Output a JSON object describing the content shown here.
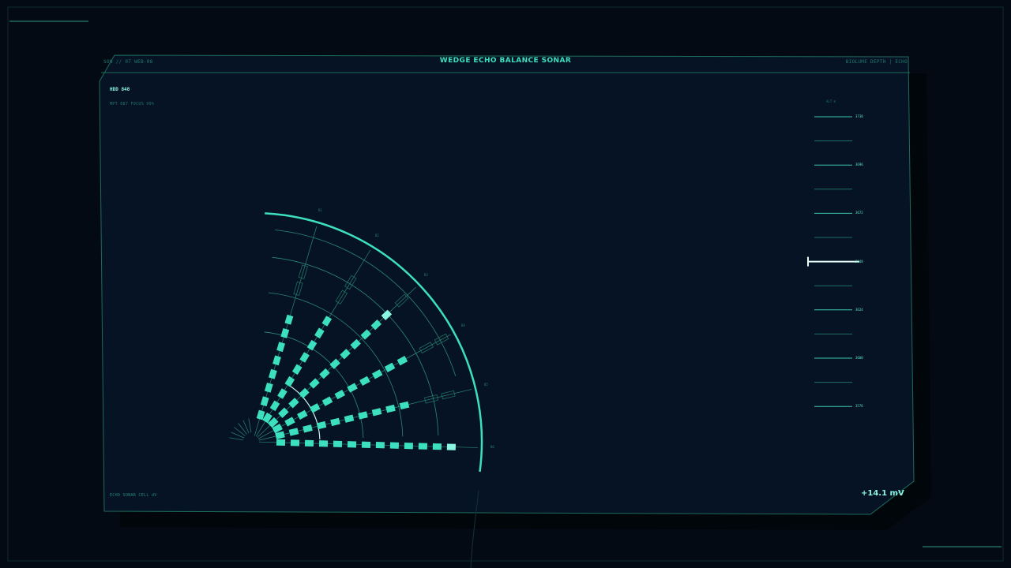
{
  "header": {
    "title": "WEDGE ECHO BALANCE SONAR",
    "left_code": "SON // 07  WEB-08",
    "right_code": "BIOLUME DEPTH | ECHO"
  },
  "status": {
    "hdd": "HDD 848",
    "sub": "MPT 087  FOCUS 99%"
  },
  "footer": {
    "left": "ECHO SONAR   CELL dV",
    "readout": "+14.1 mV"
  },
  "altimeter": {
    "title": "ALT m",
    "major_labels": [
      "3738",
      "3696",
      "3672",
      "3648",
      "3624",
      "3600",
      "3576"
    ],
    "cursor_index": 3
  },
  "sonar": {
    "beam_labels": [
      "B1",
      "B2",
      "B3",
      "B4",
      "B5",
      "B6"
    ],
    "beam_levels": [
      0.61,
      0.66,
      0.84,
      0.8,
      0.73,
      0.93
    ]
  },
  "colors": {
    "accent": "#3ce0c0",
    "accent_bright": "#8af5e0",
    "panel": "#061324",
    "frame": "#1e6b5a"
  }
}
